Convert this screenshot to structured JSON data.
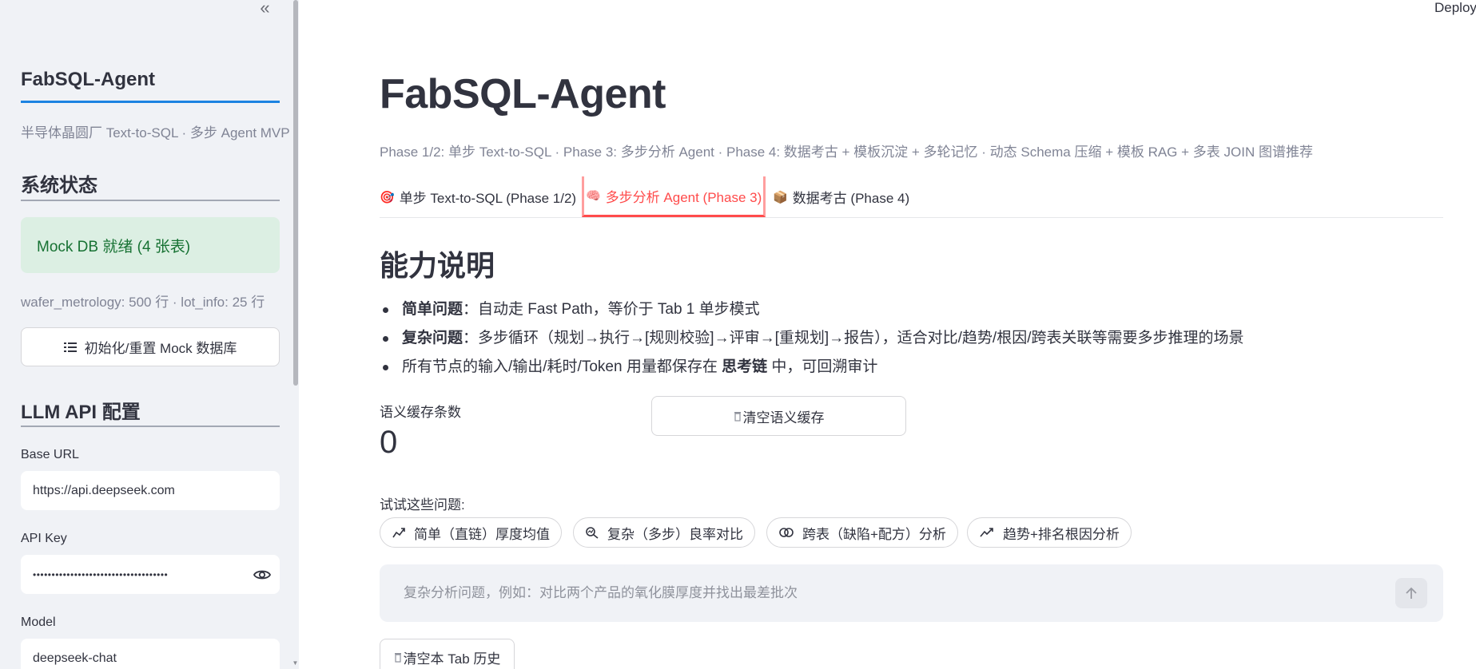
{
  "sidebar": {
    "collapse_icon": "«",
    "title": "FabSQL-Agent",
    "subtitle": "半导体晶圆厂 Text-to-SQL · 多步 Agent MVP",
    "system_status_heading": "系统状态",
    "db_status": "Mock DB 就绪 (4 张表)",
    "db_info": "wafer_metrology: 500 行 · lot_info: 25 行",
    "init_button": "初始化/重置 Mock 数据库",
    "llm_heading": "LLM API 配置",
    "base_url_label": "Base URL",
    "base_url_value": "https://api.deepseek.com",
    "api_key_label": "API Key",
    "api_key_value": "••••••••••••••••••••••••••••••••••••",
    "model_label": "Model",
    "model_value": "deepseek-chat"
  },
  "header": {
    "deploy": "Deploy"
  },
  "main": {
    "title": "FabSQL-Agent",
    "caption": "Phase 1/2: 单步 Text-to-SQL · Phase 3: 多步分析 Agent · Phase 4: 数据考古 + 模板沉淀 + 多轮记忆 · 动态 Schema 压缩 + 模板 RAG + 多表 JOIN 图谱推荐",
    "tabs": [
      {
        "icon": "🎯",
        "label": "单步 Text-to-SQL (Phase 1/2)"
      },
      {
        "icon": "🧠",
        "label": "多步分析 Agent (Phase 3)"
      },
      {
        "icon": "📦",
        "label": "数据考古 (Phase 4)"
      }
    ],
    "capability_heading": "能力说明",
    "bullets": [
      {
        "bold": "简单问题",
        "text": "：自动走 Fast Path，等价于 Tab 1 单步模式"
      },
      {
        "bold": "复杂问题",
        "text": "：多步循环（规划→执行→[规则校验]→评审→[重规划]→报告），适合对比/趋势/根因/跨表关联等需要多步推理的场景"
      },
      {
        "pre": "所有节点的输入/输出/耗时/Token 用量都保存在 ",
        "bold": "思考链",
        "post": " 中，可回溯审计"
      }
    ],
    "metric_label": "语义缓存条数",
    "metric_value": "0",
    "clear_cache_button": "清空语义缓存",
    "try_label": "试试这些问题:",
    "suggestions": [
      "简单（直链）厚度均值",
      "复杂（多步）良率对比",
      "跨表（缺陷+配方）分析",
      "趋势+排名根因分析"
    ],
    "chat_placeholder": "复杂分析问题，例如：对比两个产品的氧化膜厚度并找出最差批次",
    "clear_tab_button": "清空本 Tab 历史"
  },
  "colors": {
    "accent": "#ff4b4b",
    "success_bg": "#dcefe3",
    "success_text": "#177233",
    "sidebar_bg": "#f0f2f6",
    "rule_blue": "#1c83e1",
    "rule_gray": "#a3a8b4"
  }
}
